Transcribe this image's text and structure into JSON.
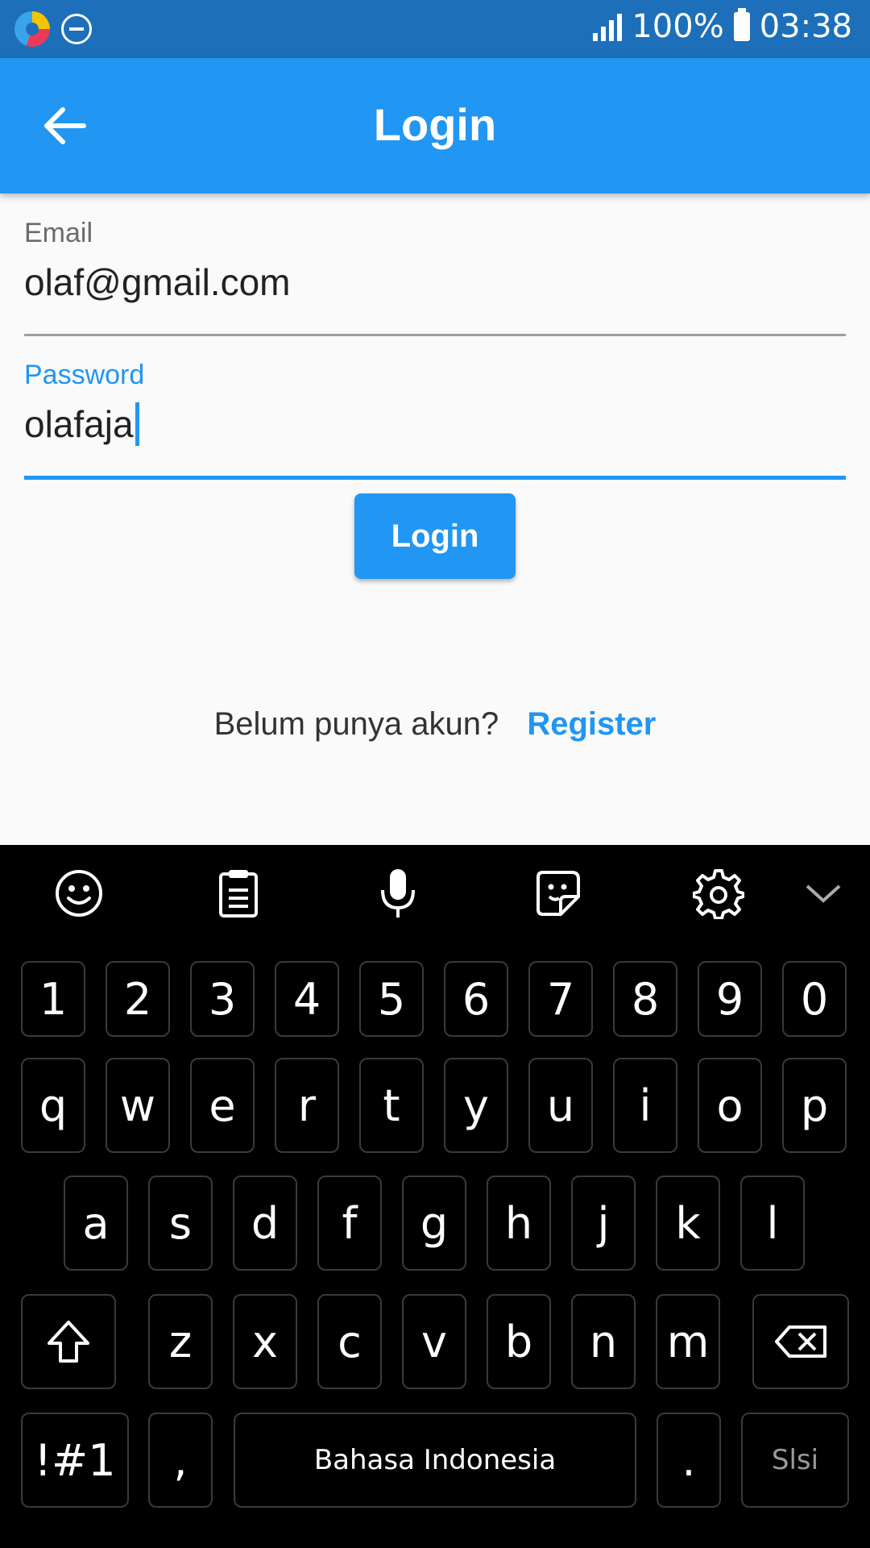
{
  "status_bar": {
    "signal_icon": "signal-bars-icon",
    "battery_text": "100%",
    "battery_icon": "battery-icon",
    "time": "03:38"
  },
  "app_bar": {
    "back_icon": "arrow-left-icon",
    "title": "Login"
  },
  "form": {
    "email": {
      "label": "Email",
      "value": "olaf@gmail.com"
    },
    "password": {
      "label": "Password",
      "value": "olafaja"
    },
    "login_button": "Login"
  },
  "register": {
    "prompt": "Belum punya akun?",
    "link": "Register"
  },
  "keyboard": {
    "toolbar_icons": [
      "emoji-icon",
      "clipboard-icon",
      "microphone-icon",
      "sticker-icon",
      "settings-gear-icon",
      "collapse-chevron-icon"
    ],
    "row_numbers": [
      "1",
      "2",
      "3",
      "4",
      "5",
      "6",
      "7",
      "8",
      "9",
      "0"
    ],
    "row_1": [
      "q",
      "w",
      "e",
      "r",
      "t",
      "y",
      "u",
      "i",
      "o",
      "p"
    ],
    "row_2": [
      "a",
      "s",
      "d",
      "f",
      "g",
      "h",
      "j",
      "k",
      "l"
    ],
    "row_3": [
      "z",
      "x",
      "c",
      "v",
      "b",
      "n",
      "m"
    ],
    "shift_icon": "shift-arrow-icon",
    "backspace_icon": "backspace-icon",
    "symbols_key": "!#1",
    "comma_key": ",",
    "space_key": "Bahasa Indonesia",
    "period_key": ".",
    "enter_key": "Slsi"
  },
  "colors": {
    "primary": "#2196f3",
    "status_bar": "#1c6fb8",
    "background": "#fafafa",
    "keyboard_bg": "#000000"
  }
}
